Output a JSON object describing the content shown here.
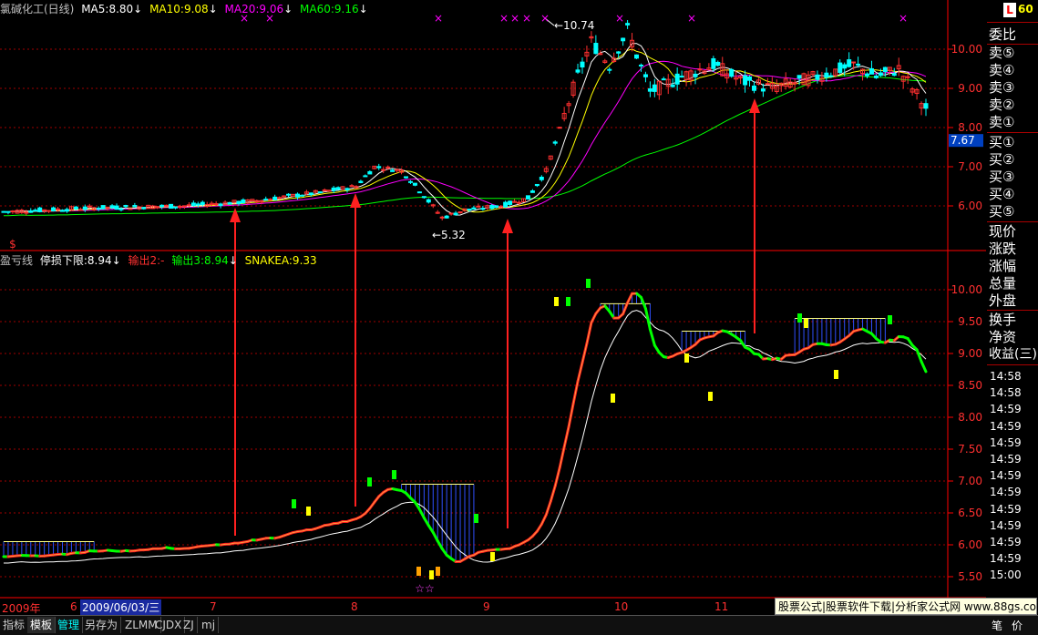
{
  "header": {
    "stock": "氯碱化工(日线)",
    "ma5": "MA5:8.80",
    "ma10": "MA10:9.08",
    "ma20": "MA20:9.06",
    "ma60": "MA60:9.16",
    "down_arrow": "↓"
  },
  "indicator": {
    "name": "盈亏线",
    "stop": "停损下限:8.94",
    "out2": "输出2:-",
    "out3": "输出3:8.94",
    "snake": "SNAKEA:9.33"
  },
  "colors": {
    "up": "#ff3030",
    "down": "#00ffff",
    "ma5": "#ffffff",
    "ma10": "#ffff00",
    "ma20": "#ff00ff",
    "ma60": "#00ff00",
    "grid": "#a00000",
    "axis": "#ff0000"
  },
  "chart_data": {
    "type": "candlestick",
    "price_axis": [
      "10.00",
      "9.00",
      "8.00",
      "7.00",
      "6.00"
    ],
    "price_label_high": "10.74",
    "price_label_low": "5.32",
    "current_price": "7.67",
    "indicator_axis": [
      "10.00",
      "9.50",
      "9.00",
      "8.50",
      "8.00",
      "7.50",
      "7.00",
      "6.50",
      "6.00",
      "5.50"
    ],
    "months": [
      "2009年",
      "6",
      "2009/06/03/三",
      "7",
      "8",
      "9",
      "10",
      "11"
    ]
  },
  "right_panel": {
    "badge_l": "L",
    "badge_num": "60",
    "items": [
      "委比",
      "卖⑤",
      "卖④",
      "卖③",
      "卖②",
      "卖①",
      "买①",
      "买②",
      "买③",
      "买④",
      "买⑤",
      "现价",
      "涨跌",
      "涨幅",
      "总量",
      "外盘",
      "换手",
      "净资",
      "收益(三)"
    ],
    "times": [
      "14:58",
      "14:58",
      "14:59",
      "14:59",
      "14:59",
      "14:59",
      "14:59",
      "14:59",
      "14:59",
      "14:59",
      "14:59",
      "14:59",
      "15:00"
    ],
    "bottom": [
      "笔",
      "价"
    ]
  },
  "watermark": "股票公式|股票软件下载|分析家公式网 www.88gs.com",
  "bottom_tabs": [
    "指标",
    "模板",
    "管理",
    "另存为",
    "ZLMM",
    "CJDX",
    "ZJ",
    "mj"
  ]
}
